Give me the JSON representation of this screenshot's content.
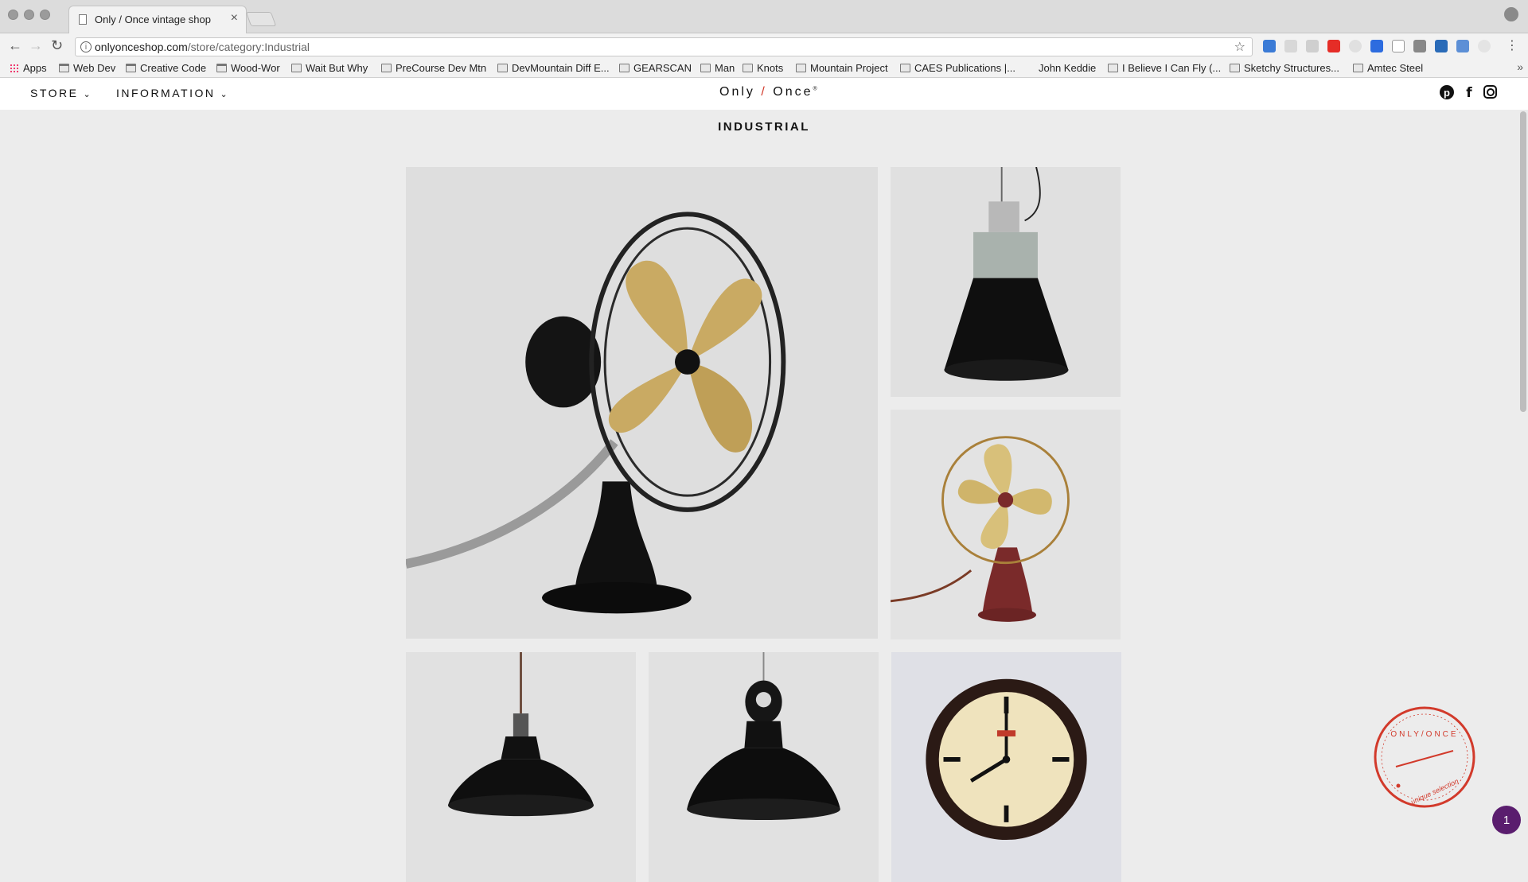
{
  "browser": {
    "tab_title": "Only / Once vintage shop",
    "tab_close": "×",
    "url_host": "onlyonceshop.com",
    "url_path": "/store/category:Industrial",
    "bookmarks": [
      {
        "label": "Apps",
        "icon": "apps-grid-icon"
      },
      {
        "label": "Web Dev",
        "icon": "folder-icon"
      },
      {
        "label": "Creative Code",
        "icon": "folder-icon"
      },
      {
        "label": "Wood-Wor",
        "icon": "folder-icon"
      },
      {
        "label": "Wait But Why",
        "icon": "waitbutwhy-icon"
      },
      {
        "label": "PreCourse Dev Mtn",
        "icon": "page-icon"
      },
      {
        "label": "DevMountain Diff E...",
        "icon": "page-icon"
      },
      {
        "label": "GEARSCAN",
        "icon": "page-icon"
      },
      {
        "label": "Man",
        "icon": "page-icon"
      },
      {
        "label": "Knots",
        "icon": "page-icon"
      },
      {
        "label": "Mountain Project",
        "icon": "page-icon"
      },
      {
        "label": "CAES Publications |...",
        "icon": "page-icon"
      },
      {
        "label": "John Keddie",
        "icon": "none"
      },
      {
        "label": "I Believe I Can Fly (...",
        "icon": "page-icon"
      },
      {
        "label": "Sketchy Structures...",
        "icon": "page-icon"
      },
      {
        "label": "Amtec Steel",
        "icon": "page-icon"
      }
    ],
    "bookmarks_more": "»"
  },
  "site": {
    "nav": {
      "store_label": "STORE",
      "information_label": "INFORMATION",
      "chevron": "⌄"
    },
    "logo": {
      "left": "Only",
      "slash": "/",
      "right": "Once",
      "mark": "®"
    },
    "social": {
      "pinterest": "p",
      "facebook": "f"
    }
  },
  "page": {
    "title": "INDUSTRIAL"
  },
  "products": [
    {
      "name": "desk-fan-black-brass",
      "type": "fan"
    },
    {
      "name": "pendant-lamp-grey-black",
      "type": "industrial-pendant"
    },
    {
      "name": "desk-fan-red-brass",
      "type": "fan"
    },
    {
      "name": "pendant-lamp-enamel-black-1",
      "type": "enamel-pendant"
    },
    {
      "name": "pendant-lamp-enamel-black-2",
      "type": "enamel-pendant"
    },
    {
      "name": "wall-clock",
      "type": "clock"
    }
  ],
  "stamp": {
    "top_text": "ONLY/ONCE",
    "bottom_text": "unique selection"
  },
  "chat_badge": "1",
  "colors": {
    "accent": "#d23a2b",
    "background": "#ececec",
    "badge": "#5a1d6e"
  }
}
